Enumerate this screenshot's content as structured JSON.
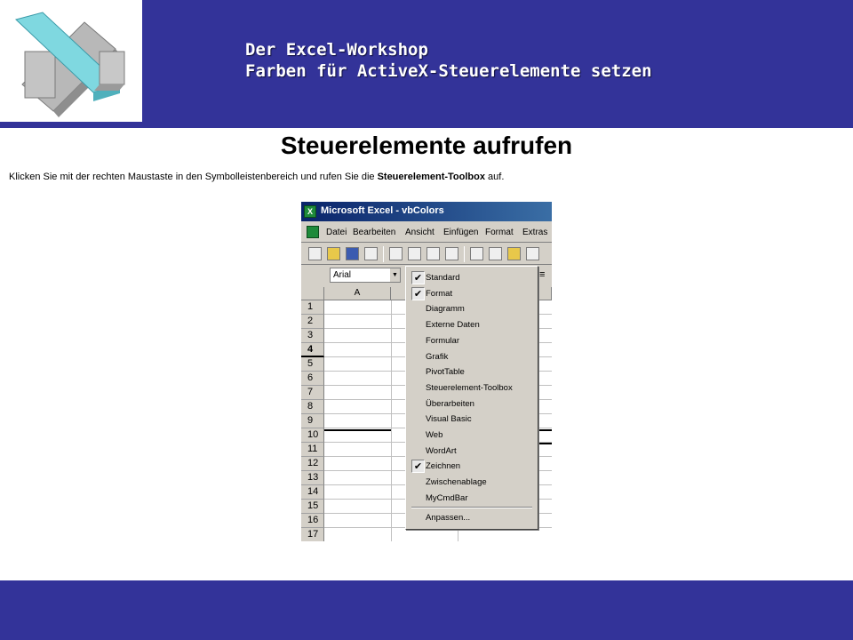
{
  "header": {
    "line1": "Der Excel-Workshop",
    "line2": "Farben für ActiveX-Steuerelemente setzen",
    "logo_icon": "excel-x-logo-icon"
  },
  "slide": {
    "title": "Steuerelemente aufrufen",
    "instruction_prefix": "Klicken Sie mit der rechten Maustaste in den Symbolleistenbereich und rufen Sie die ",
    "instruction_bold": "Steuerelement-Toolbox",
    "instruction_suffix": "  auf."
  },
  "excel": {
    "window_title": "Microsoft Excel - vbColors",
    "menu": [
      "Datei",
      "Bearbeiten",
      "Ansicht",
      "Einfügen",
      "Format",
      "Extras"
    ],
    "font_name": "Arial",
    "column_a": "A",
    "rows": [
      "1",
      "2",
      "3",
      "4",
      "5",
      "6",
      "7",
      "8",
      "9",
      "10",
      "11",
      "12",
      "13",
      "14",
      "15",
      "16",
      "17"
    ],
    "active_row": "4"
  },
  "context_menu": {
    "items": [
      {
        "label": "Standard",
        "checked": true
      },
      {
        "label": "Format",
        "checked": true
      },
      {
        "label": "Diagramm",
        "checked": false
      },
      {
        "label": "Externe Daten",
        "checked": false
      },
      {
        "label": "Formular",
        "checked": false
      },
      {
        "label": "Grafik",
        "checked": false
      },
      {
        "label": "PivotTable",
        "checked": false
      },
      {
        "label": "Steuerelement-Toolbox",
        "checked": false
      },
      {
        "label": "Überarbeiten",
        "checked": false
      },
      {
        "label": "Visual Basic",
        "checked": false
      },
      {
        "label": "Web",
        "checked": false
      },
      {
        "label": "WordArt",
        "checked": false
      },
      {
        "label": "Zeichnen",
        "checked": true
      },
      {
        "label": "Zwischenablage",
        "checked": false
      },
      {
        "label": "MyCmdBar",
        "checked": false
      }
    ],
    "customize": "Anpassen..."
  },
  "colors": {
    "brand_blue": "#333399",
    "titlebar_blue": "#0a246a",
    "menu_gray": "#d4d0c8"
  }
}
